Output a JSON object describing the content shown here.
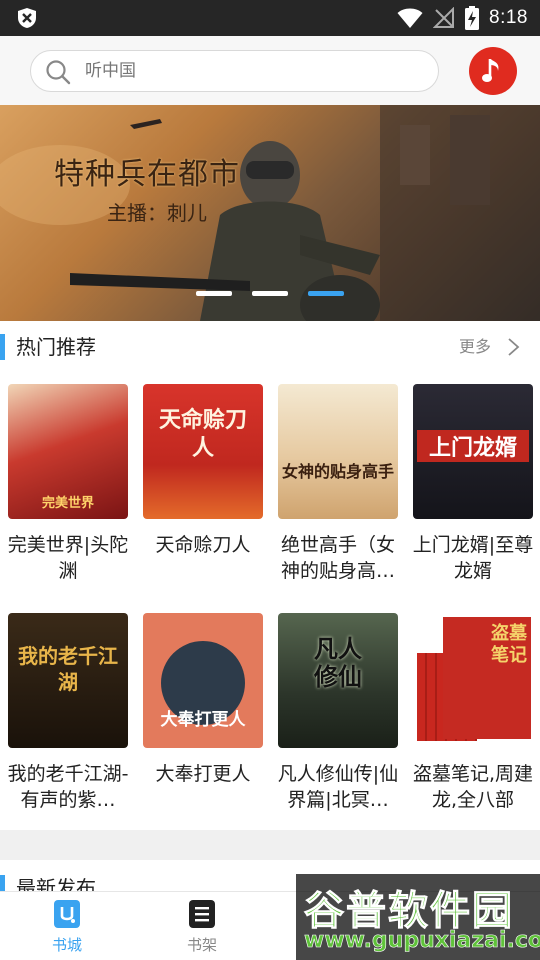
{
  "status_bar": {
    "time": "8:18"
  },
  "search": {
    "placeholder": "听中国"
  },
  "banner": {
    "title": "特种兵在都市",
    "subtitle": "主播：刺儿",
    "slide_count": 3,
    "active_slide": 3
  },
  "hot_section": {
    "title": "热门推荐",
    "more_label": "更多",
    "books": [
      {
        "name": "完美世界|头陀渊",
        "cover_text": "完美世界",
        "cover_color": "#9b2020"
      },
      {
        "name": "天命赊刀人",
        "cover_text": "天命赊刀人",
        "cover_color": "#d1302a"
      },
      {
        "name": "绝世高手（女神的贴身高…",
        "cover_text": "女神的贴身高手",
        "cover_color": "#d9c3a0"
      },
      {
        "name": "上门龙婿|至尊龙婿",
        "cover_text": "上门龙婿",
        "cover_color": "#1c1c22"
      },
      {
        "name": "我的老千江湖-有声的紫…",
        "cover_text": "我的老千江湖",
        "cover_color": "#241a12"
      },
      {
        "name": "大奉打更人",
        "cover_text": "大奉打更人",
        "cover_color": "#e37a5c"
      },
      {
        "name": "凡人修仙传|仙界篇|北冥…",
        "cover_text": "凡人修仙",
        "cover_color": "#3e4a3a"
      },
      {
        "name": "盗墓笔记,周建龙,全八部",
        "cover_text": "盗墓笔记",
        "cover_color": "#c52a22"
      }
    ]
  },
  "new_section": {
    "title": "最新发布"
  },
  "bottom_nav": [
    {
      "label": "书城",
      "icon": "bookstore-icon",
      "active": true
    },
    {
      "label": "书架",
      "icon": "bookshelf-icon",
      "active": false
    }
  ],
  "watermark": {
    "text": "谷普软件园",
    "url": "www.gupuxiazai.com"
  },
  "colors": {
    "accent": "#3aa3f0",
    "music_button": "#e02b1f",
    "active_nav": "#3aa3f0",
    "inactive_nav": "#888888"
  }
}
